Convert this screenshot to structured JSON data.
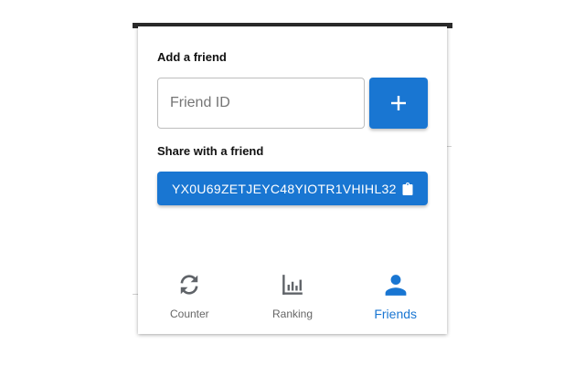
{
  "add_friend": {
    "title": "Add a friend",
    "input_placeholder": "Friend ID",
    "input_value": "",
    "add_button_icon": "plus-icon"
  },
  "share": {
    "title": "Share with a friend",
    "friend_code": "YX0U69ZETJEYC48YIOTR1VHIHL32",
    "copy_icon": "clipboard-icon"
  },
  "nav": {
    "items": [
      {
        "label": "Counter",
        "icon": "refresh-icon",
        "active": false
      },
      {
        "label": "Ranking",
        "icon": "bar-chart-icon",
        "active": false
      },
      {
        "label": "Friends",
        "icon": "person-icon",
        "active": true
      }
    ]
  },
  "colors": {
    "primary": "#1976d2",
    "inactive": "#666666",
    "border": "#bdbdbd"
  }
}
